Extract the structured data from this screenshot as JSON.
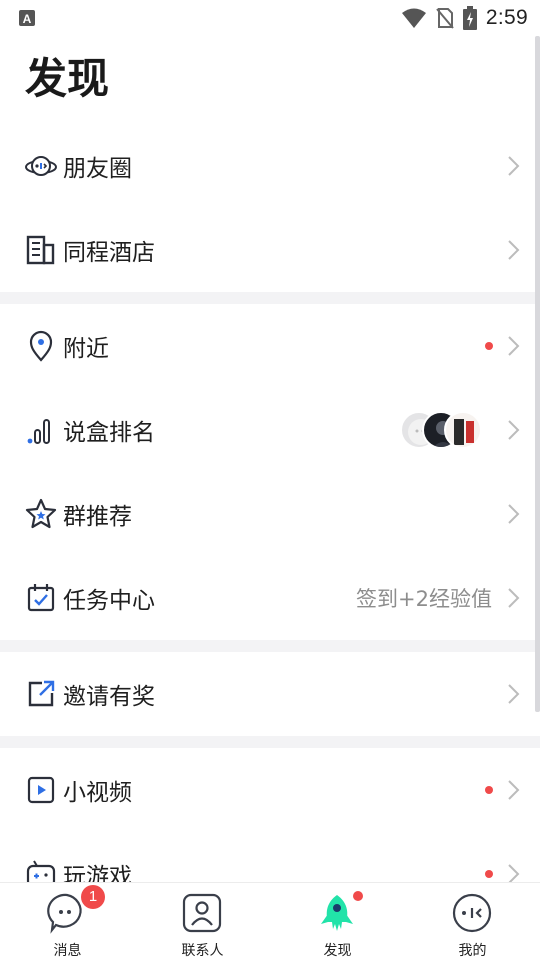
{
  "status_bar": {
    "time": "2:59"
  },
  "page": {
    "title": "发现"
  },
  "menu": [
    {
      "label": "朋友圈",
      "icon": "planet-chat-icon"
    },
    {
      "label": "同程酒店",
      "icon": "building-icon"
    },
    {
      "label": "附近",
      "icon": "location-pin-icon",
      "dot": true
    },
    {
      "label": "说盒排名",
      "icon": "ranking-bars-icon"
    },
    {
      "label": "群推荐",
      "icon": "star-icon"
    },
    {
      "label": "任务中心",
      "icon": "calendar-check-icon",
      "extra": "签到+2经验值"
    },
    {
      "label": "邀请有奖",
      "icon": "share-out-icon"
    },
    {
      "label": "小视频",
      "icon": "play-video-icon",
      "dot": true
    },
    {
      "label": "玩游戏",
      "icon": "gamepad-icon",
      "dot": true
    }
  ],
  "tabs": [
    {
      "label": "消息",
      "badge": "1"
    },
    {
      "label": "联系人"
    },
    {
      "label": "发现",
      "active": true,
      "dot": true
    },
    {
      "label": "我的"
    }
  ],
  "colors": {
    "accent_green": "#22e3a9",
    "badge_red": "#f04a4a",
    "icon_blue": "#2f6fe4",
    "icon_dark": "#2b2f3a"
  }
}
